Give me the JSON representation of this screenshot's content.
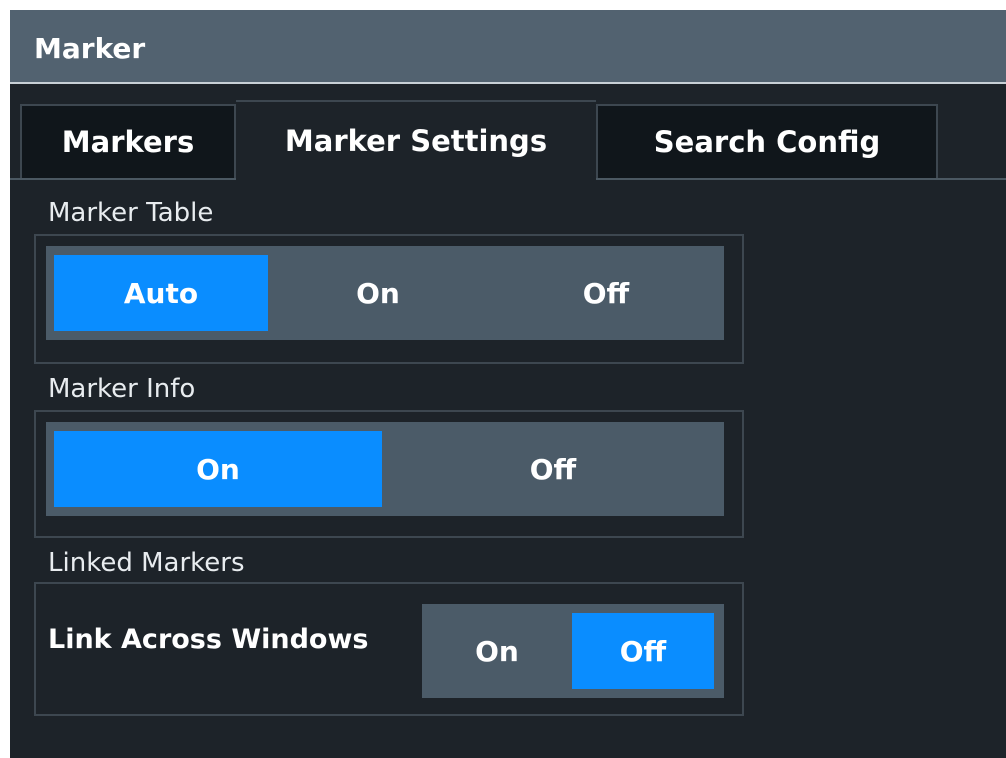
{
  "window": {
    "title": "Marker"
  },
  "tabs": [
    {
      "label": "Markers",
      "active": false
    },
    {
      "label": "Marker Settings",
      "active": true
    },
    {
      "label": "Search Config",
      "active": false
    }
  ],
  "marker_table": {
    "label": "Marker Table",
    "options": [
      "Auto",
      "On",
      "Off"
    ],
    "selected": "Auto"
  },
  "marker_info": {
    "label": "Marker Info",
    "options": [
      "On",
      "Off"
    ],
    "selected": "On"
  },
  "linked_markers": {
    "label": "Linked Markers",
    "link_across_windows": {
      "label": "Link Across Windows",
      "options": [
        "On",
        "Off"
      ],
      "selected": "Off"
    }
  },
  "colors": {
    "selected": "#0a8dff",
    "titlebar": "#526270",
    "background": "#1d2329"
  }
}
